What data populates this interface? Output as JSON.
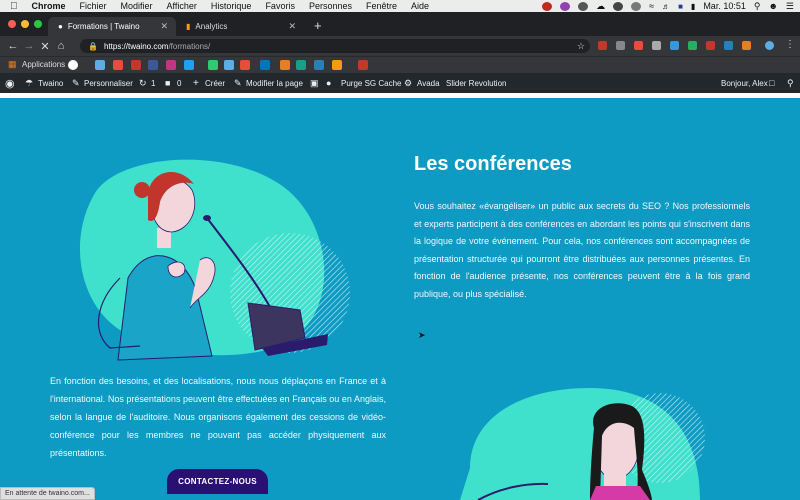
{
  "menubar": {
    "app": "Chrome",
    "items": [
      "Fichier",
      "Modifier",
      "Afficher",
      "Historique",
      "Favoris",
      "Personnes",
      "Fenêtre",
      "Aide"
    ],
    "clock": "Mar. 10:51"
  },
  "tabs": [
    {
      "title": "Formations | Twaino"
    },
    {
      "title": "Analytics"
    }
  ],
  "address": {
    "host": "https://twaino.com",
    "path": "/formations/"
  },
  "bookmarks": {
    "apps_label": "Applications"
  },
  "wp_admin": {
    "site": "Twaino",
    "customize": "Personnaliser",
    "updates": "1",
    "comments": "0",
    "create": "Créer",
    "edit": "Modifier la page",
    "purge": "Purge SG Cache",
    "avada": "Avada",
    "slider": "Slider Revolution",
    "greeting": "Bonjour, Alex"
  },
  "section1": {
    "title": "Les conférences",
    "text": "Vous souhaitez «évangéliser» un public aux secrets du SEO ? Nos professionnels et experts participent à des conférences en abordant les points qui s'inscrivent dans la logique de votre événement. Pour cela, nos conférences sont accompagnées de présentation structurée qui pourront être distribuées aux personnes présentes. En fonction de l'audience présente, nos conférences peuvent être à la fois grand publique, ou plus spécialisé."
  },
  "section2": {
    "text": "En fonction des besoins, et des localisations, nous nous déplaçons en France et à l'international. Nos présentations peuvent être effectuées en Français ou en Anglais, selon la langue de l'auditoire. Nous organisons également des cessions de vidéo-conférence pour les membres ne pouvant pas accéder physiquement aux présentations.",
    "cta": "CONTACTEZ-NOUS"
  },
  "status": "En attente de twaino.com...",
  "colors": {
    "page_bg": "#0d9bc4",
    "blob": "#3fe0cc",
    "cta_bg": "#2a1072"
  }
}
